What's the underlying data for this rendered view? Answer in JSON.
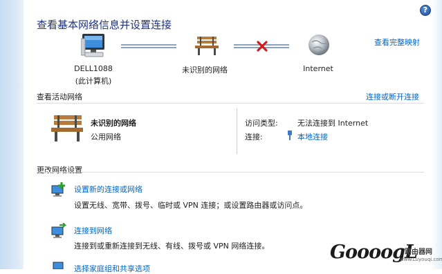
{
  "title": "查看基本网络信息并设置连接",
  "help_label": "?",
  "map_link": "查看完整映射",
  "map": {
    "computer_name": "DELL1088",
    "computer_sub": "(此计算机)",
    "network_name": "未识别的网络",
    "internet_label": "Internet"
  },
  "active": {
    "section_title": "查看活动网络",
    "connect_disconnect_link": "连接或断开连接",
    "network_name": "未识别的网络",
    "network_type": "公用网络",
    "access_type_label": "访问类型:",
    "access_type_value": "无法连接到 Internet",
    "connections_label": "连接:",
    "connections_value": "本地连接"
  },
  "settings": {
    "section_title": "更改网络设置",
    "tasks": [
      {
        "title": "设置新的连接或网络",
        "desc": "设置无线、宽带、拨号、临时或 VPN 连接；或设置路由器或访问点。"
      },
      {
        "title": "连接到网络",
        "desc": "连接到或重新连接到无线、有线、拨号或 VPN 网络连接。"
      },
      {
        "title": "选择家庭组和共享选项"
      }
    ]
  },
  "watermark": {
    "brand": "GoooogL",
    "site": "路由器网",
    "domain": "www.Luyouqi.com"
  }
}
